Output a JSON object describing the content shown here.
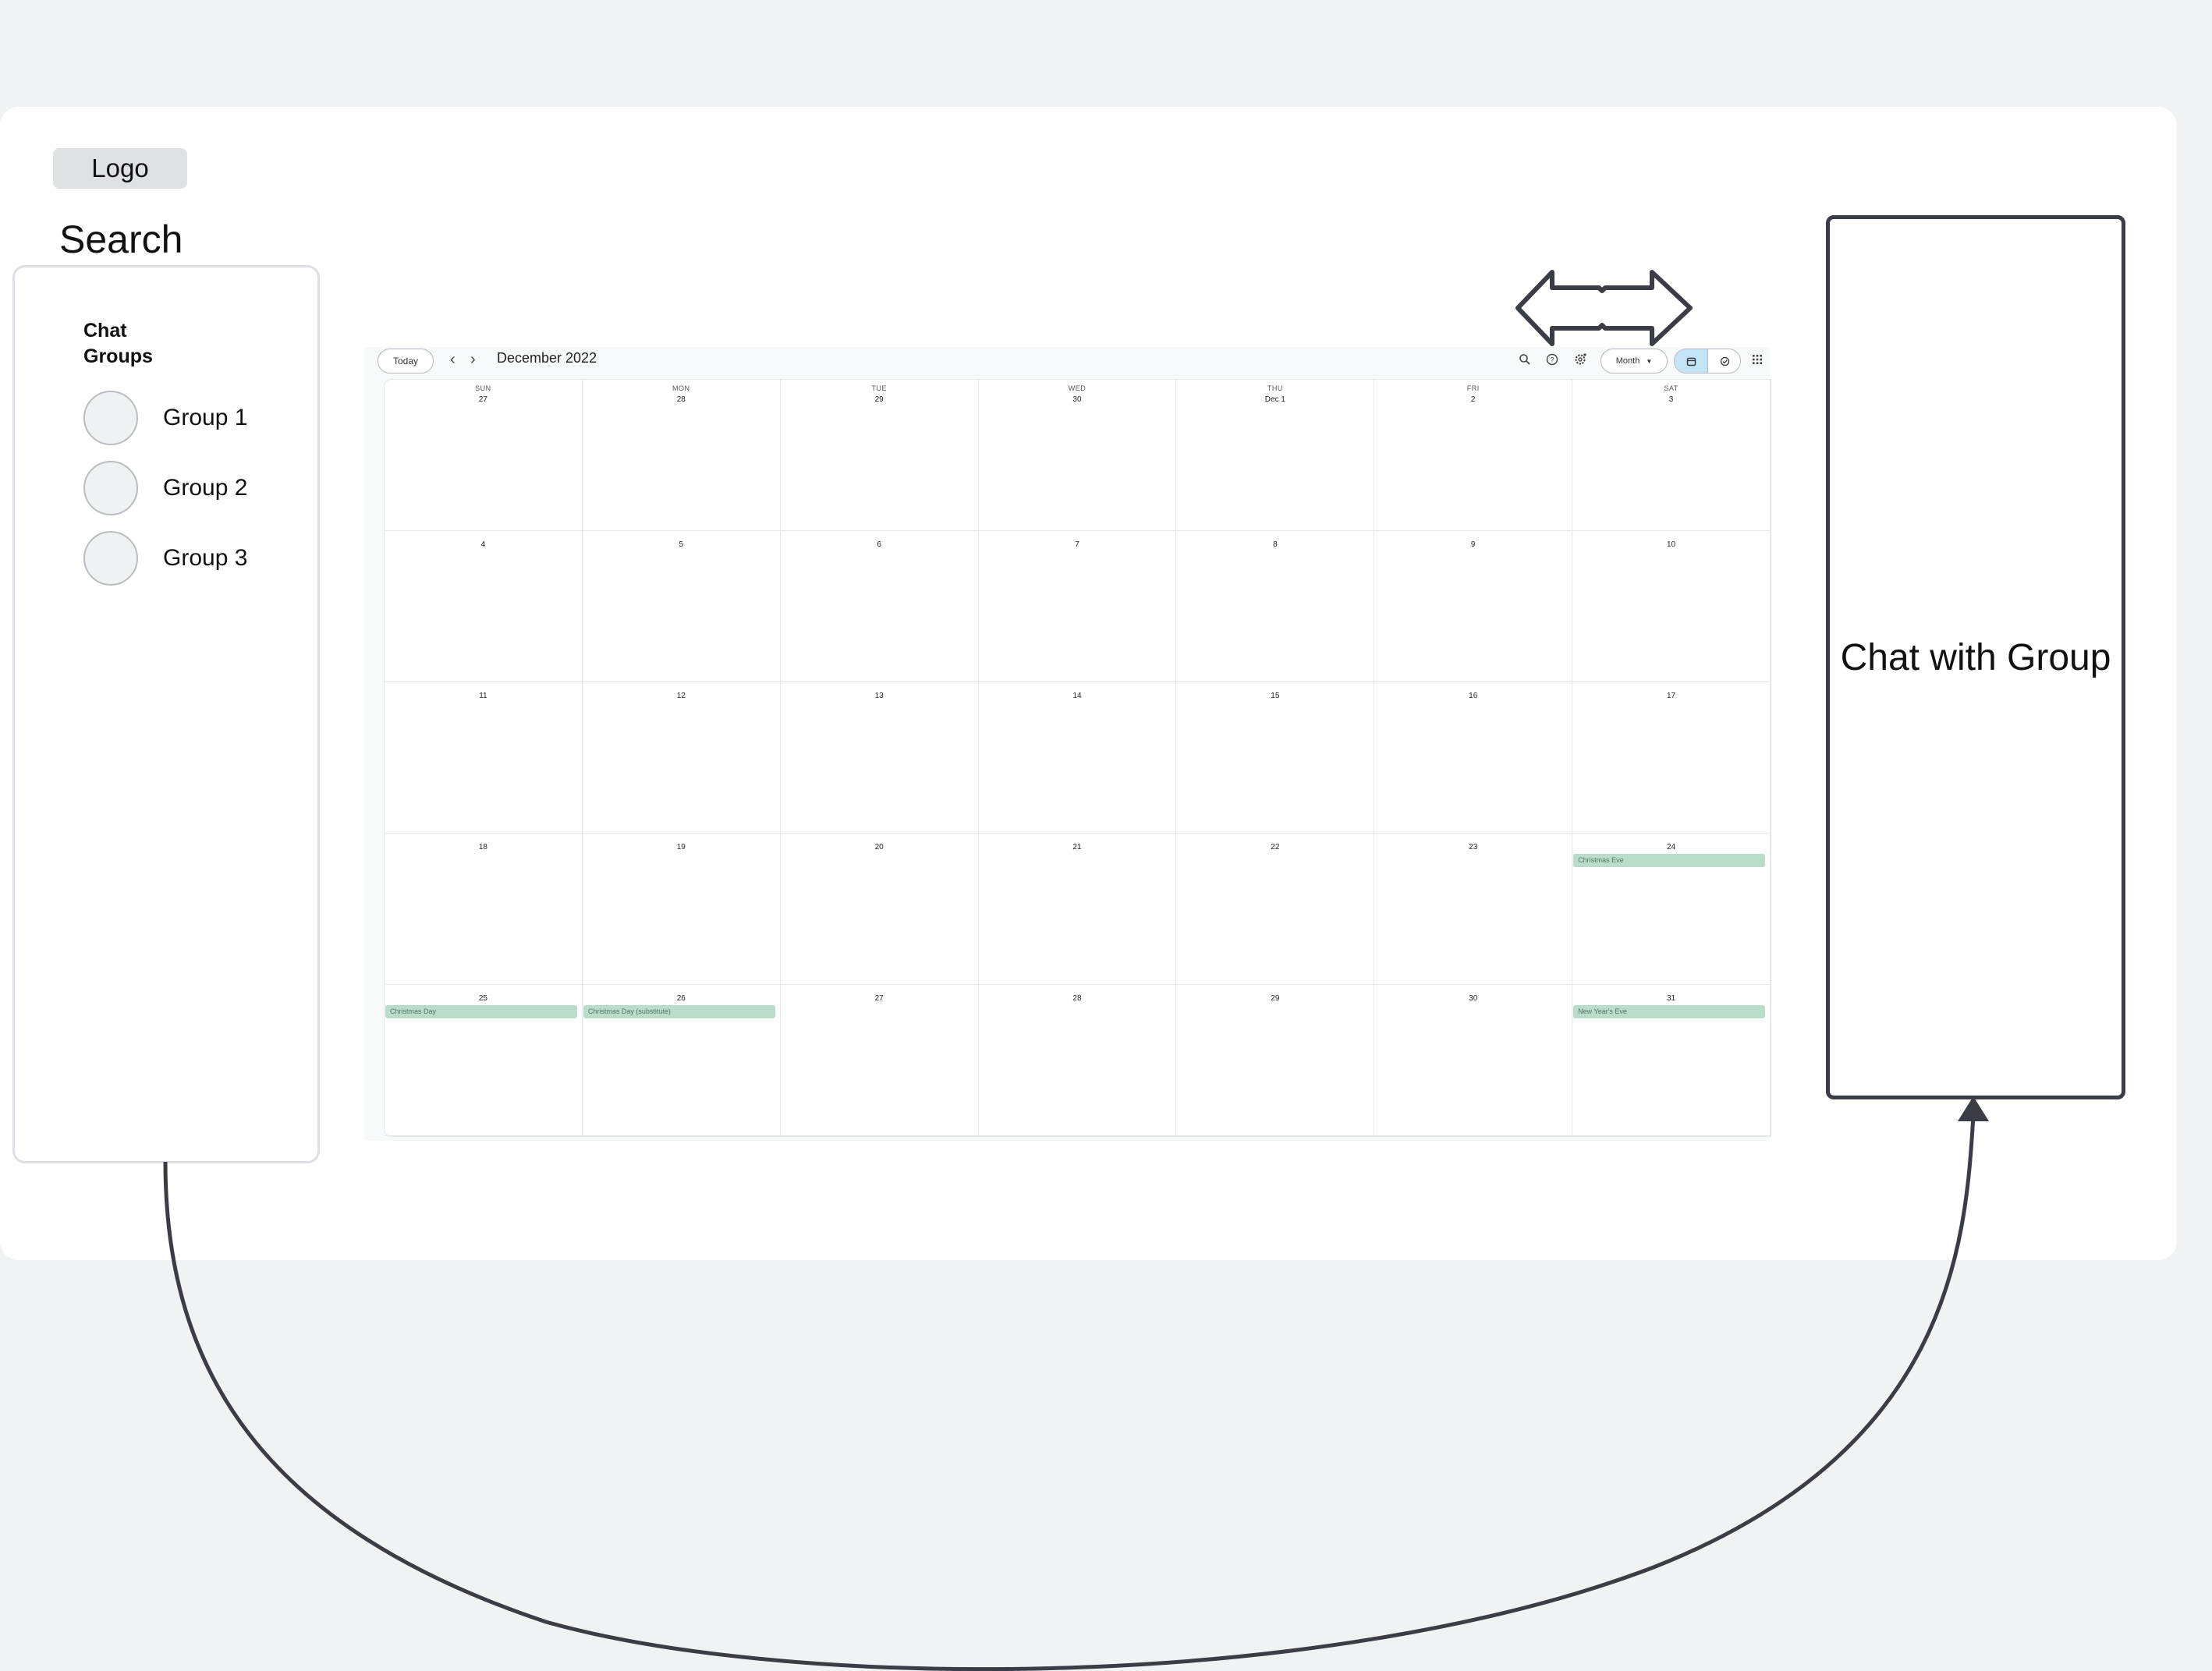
{
  "logo": "Logo",
  "search_label": "Search",
  "chat_panel": {
    "title": "Chat Groups",
    "groups": [
      "Group 1",
      "Group 2",
      "Group 3"
    ]
  },
  "calendar": {
    "today_label": "Today",
    "title": "December 2022",
    "view_label": "Month",
    "weekdays": [
      "SUN",
      "MON",
      "TUE",
      "WED",
      "THU",
      "FRI",
      "SAT"
    ],
    "weeks": [
      [
        "27",
        "28",
        "29",
        "30",
        "Dec 1",
        "2",
        "3"
      ],
      [
        "4",
        "5",
        "6",
        "7",
        "8",
        "9",
        "10"
      ],
      [
        "11",
        "12",
        "13",
        "14",
        "15",
        "16",
        "17"
      ],
      [
        "18",
        "19",
        "20",
        "21",
        "22",
        "23",
        "24"
      ],
      [
        "25",
        "26",
        "27",
        "28",
        "29",
        "30",
        "31"
      ]
    ],
    "events": [
      {
        "week": 3,
        "day": 6,
        "label": "Christmas Eve"
      },
      {
        "week": 4,
        "day": 0,
        "label": "Christmas Day"
      },
      {
        "week": 4,
        "day": 1,
        "label": "Christmas Day (substitute)"
      },
      {
        "week": 4,
        "day": 6,
        "label": "New Year's Eve"
      }
    ],
    "event_color": "#b9dccb"
  },
  "chat_with_group_label": "Chat with Group",
  "colors": {
    "connector": "#3a3d45",
    "background": "#f1f2f4"
  }
}
